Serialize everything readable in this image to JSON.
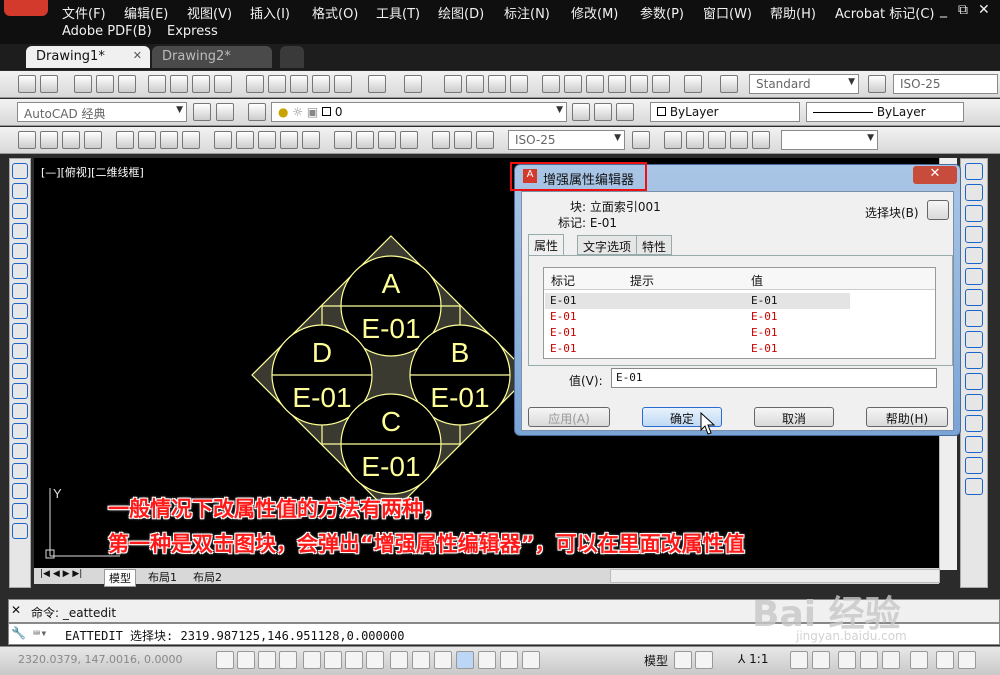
{
  "menubar": {
    "items": [
      "文件(F)",
      "编辑(E)",
      "视图(V)",
      "插入(I)",
      "格式(O)",
      "工具(T)",
      "绘图(D)",
      "标注(N)",
      "修改(M)",
      "参数(P)",
      "窗口(W)",
      "帮助(H)",
      "Acrobat 标记(C)"
    ],
    "row2": [
      "Adobe PDF(B)",
      "Express"
    ],
    "controls": [
      "_",
      "⧉",
      "✕"
    ]
  },
  "tabs": [
    {
      "label": "Drawing1*",
      "close": "✕"
    },
    {
      "label": "Drawing2*"
    }
  ],
  "toolbar": {
    "text_style": "Standard",
    "dim_style": "ISO-25",
    "workspace": "AutoCAD 经典",
    "layer": "0",
    "color": "ByLayer",
    "linetype": "ByLayer",
    "dim_style2": "ISO-25"
  },
  "canvas": {
    "view_label": "[—][俯视][二维线框]",
    "block_labels": {
      "top": "A",
      "left": "D",
      "right": "B",
      "bottom": "C",
      "value": "E-01"
    },
    "colors": {
      "background": "#000000",
      "block": "#ffff99",
      "accent": "#d43a2b"
    }
  },
  "layout_tabs": [
    "模型",
    "布局1",
    "布局2"
  ],
  "dialog": {
    "title": "增强属性编辑器",
    "block_label": "块: 立面索引001",
    "tag_label": "标记: E-01",
    "select_block": "选择块(B)",
    "tabs": [
      "属性",
      "文字选项",
      "特性"
    ],
    "columns": [
      "标记",
      "提示",
      "值"
    ],
    "rows": [
      {
        "tag": "E-01",
        "prompt": "",
        "value": "E-01"
      },
      {
        "tag": "E-01",
        "prompt": "",
        "value": "E-01"
      },
      {
        "tag": "E-01",
        "prompt": "",
        "value": "E-01"
      },
      {
        "tag": "E-01",
        "prompt": "",
        "value": "E-01"
      }
    ],
    "value_label": "值(V):",
    "value": "E-01",
    "buttons": {
      "apply": "应用(A)",
      "ok": "确定",
      "cancel": "取消",
      "help": "帮助(H)"
    }
  },
  "command": {
    "line1": "命令: _eattedit",
    "line2": "EATTEDIT 选择块: 2319.987125,146.951128,0.000000"
  },
  "status": {
    "coords": "2320.0379, 147.0016, 0.0000",
    "model": "模型",
    "scale": "1:1"
  },
  "caption": {
    "line1": "一般情况下改属性值的方法有两种，",
    "line2": "第一种是双击图块，会弹出“增强属性编辑器”，可以在里面改属性值"
  },
  "watermark": {
    "brand": "Bai 经验",
    "url": "jingyan.baidu.com"
  }
}
